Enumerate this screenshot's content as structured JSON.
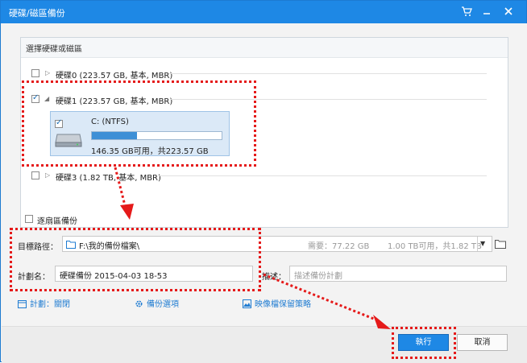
{
  "window": {
    "title": "硬碟/磁區備份"
  },
  "panel": {
    "header": "選擇硬碟或磁區"
  },
  "disks": [
    {
      "label": "硬碟0 (223.57 GB, 基本, MBR)",
      "checked": false
    },
    {
      "label": "硬碟1 (223.57 GB, 基本, MBR)",
      "checked": true
    },
    {
      "label": "硬碟3 (1.82 TB, 基本, MBR)",
      "checked": false
    }
  ],
  "partition": {
    "name": "C: (NTFS)",
    "info": "146.35 GB可用，共223.57 GB",
    "used_fraction": 0.35
  },
  "sector_backup": {
    "label": "逐扇區備份"
  },
  "target": {
    "label": "目標路徑：",
    "path": "F:\\我的備份檔案\\",
    "required": "需要：77.22 GB",
    "free": "1.00 TB可用，共1.82 TB"
  },
  "plan": {
    "label": "計劃名：",
    "value": "硬碟備份 2015-04-03 18-53",
    "desc_label": "描述：",
    "desc_placeholder": "描述備份計劃"
  },
  "links": {
    "schedule": "計劃：關閉",
    "options": "備份選項",
    "retention": "映像檔保留策略"
  },
  "buttons": {
    "execute": "執行",
    "cancel": "取消"
  },
  "colors": {
    "accent": "#1e88e5",
    "annotation": "#e51a1a"
  }
}
